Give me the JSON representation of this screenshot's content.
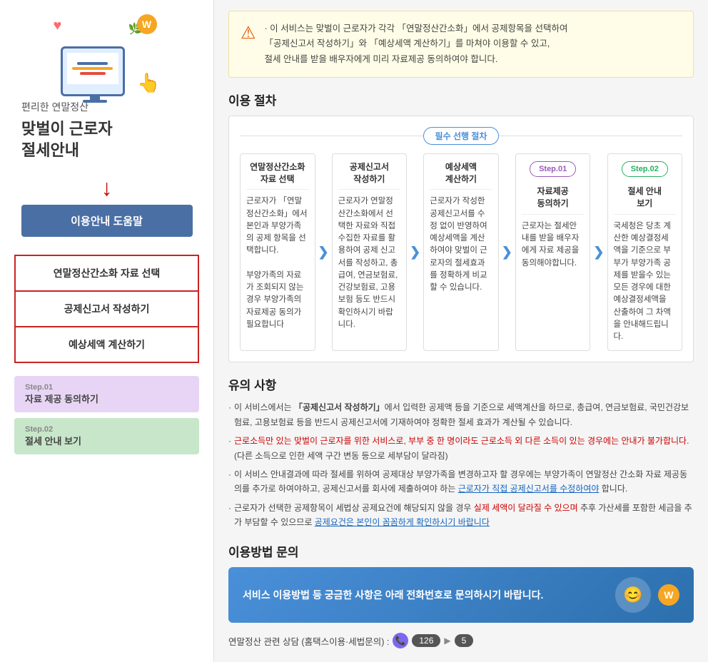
{
  "sidebar": {
    "title": "맞벌이 근로자\n절세안내",
    "help_button": "이용안내 도움말",
    "nav_items": [
      {
        "label": "연말정산간소화 자료 선택"
      },
      {
        "label": "공제신고서 작성하기"
      },
      {
        "label": "예상세액 계산하기"
      }
    ],
    "step01": {
      "label": "Step.01",
      "text": "자료 제공 동의하기"
    },
    "step02": {
      "label": "Step.02",
      "text": "절세 안내 보기"
    }
  },
  "notice": {
    "text": "이 서비스는 맞벌이 근로자가 각각 「연말정산간소화」에서 공제항목을 선택하여\n「공제신고서 작성하기」와 「예상세액 계산하기」를 마쳐야 이용할 수 있고,\n절세 안내를 받을 배우자에게 미리 자료제공 동의하여야 합니다."
  },
  "procedure": {
    "section_title": "이용 절차",
    "prerequisite_label": "필수 선행 절차",
    "steps": [
      {
        "title": "연말정산간소화\n자료 선택",
        "body": "근로자가 「연말정산간소화」에서 본인과 부양가족의 공제 항목을 선택합니다.\n\n부양가족의 자료가 조회되지 않는 경우 부양가족의 자료제공 동의가 필요합니다"
      },
      {
        "title": "공제신고서\n작성하기",
        "body": "근로자가 연말정산간소화에서 선택한 자료와 직접 수집한 자료를 활용하여 공제 신고서를 작성하고, 총급여, 연금보험료, 건강보험료, 고용보험 등도 반드시 확인하시기 바랍니다."
      },
      {
        "title": "예상세액\n계산하기",
        "body": "근로자가 작성한 공제신고서를 수정 없이 반영하여 예상세액을 계산하여야 맞벌이 근로자의 절세효과를 정확하게 비교할 수 있습니다."
      }
    ],
    "step01": {
      "badge": "Step.01",
      "title": "자료제공\n동의하기",
      "body": "근로자는 절세안내를 받을 배우자에게 자료 제공을 동의해야합니다."
    },
    "step02": {
      "badge": "Step.02",
      "title": "절세 안내\n보기",
      "body": "국세청은 당초 계산한 예상결정세액을 기준으로 부부가 부양가족 공제를 받을수 있는 모든 경우에 대한 예상결정세액을 산출하여 그 차액을 안내해드립니다."
    }
  },
  "notes": {
    "section_title": "유의 사항",
    "items": [
      {
        "text": "이 서비스에서는 「공제신고서 작성하기」에서 입력한 공제액 등을 기준으로 세액계산을 하므로, 총급여, 연금보험료, 국민건강보험료, 고용보험료 등을 반드시 공제신고서에 기재하여야 정확한 절세 효과가 계산될 수 있습니다.",
        "highlight_range": [
          9,
          19
        ]
      },
      {
        "text": "근로소득만 있는 맞벌이 근로자를 위한 서비스로, 부부 중 한 명이라도 근로소득 외 다른 소득이  있는 경우에는 안내가 불가합니다.(다른 소득으로 인한 세액 구간 변동 등으로 세부담이 달라짐)",
        "highlight_class": "note-highlight"
      },
      {
        "text": "이 서비스 안내결과에 따라 절세를 위하여 공제대상 부양가족을 변경하고자 할 경우에는 부양가족이 연말정산 간소화 자료 제공동의를 추가로 하여야하고, 공제신고서를 회사에 제출하여야 하는 근로자가 직접 공제신고서를 수정하여야 합니다."
      },
      {
        "text": "근로자가 선택한 공제항목이 세법상 공제요건에 해당되지 않을 경우 실제 세액이 달라질 수 있으며 추후 가산세를 포함한 세금을 추가 부담할 수 있으므로 공제요건은 본인이 꼼꼼하게 확인하시기 바랍니다"
      }
    ]
  },
  "contact": {
    "section_title": "이용방법 문의",
    "banner_text": "서비스 이용방법 등 궁금한 사항은 아래 전화번호로 문의하시기 바랍니다.",
    "phone_label": "연말정산 관련 상담 (홈택스이용·세법문의) :",
    "phone_number": "126",
    "phone_suffix": "5"
  }
}
